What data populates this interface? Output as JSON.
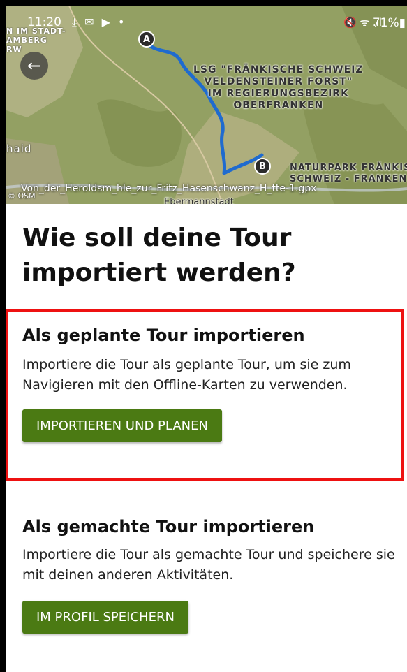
{
  "status_bar": {
    "time": "11:20",
    "left_icons": "⤓ ✉ ▶ •",
    "right_icons": "🔇 ᯤ .ıl",
    "battery": "71%"
  },
  "map": {
    "label_lsg": [
      "LSG \"FRÄNKISCHE SCHWEIZ",
      "VELDENSTEINER FORST\"",
      "IM REGIERUNGSBEZIRK",
      "OBERFRANKEN"
    ],
    "label_naturpark": [
      "NATURPARK FRÄNKIS",
      "SCHWEIZ - FRANKEN"
    ],
    "label_stadt": [
      "N IM STADT-",
      "AMBERG",
      "RW"
    ],
    "label_haid": "haid",
    "label_town": "Ebermannstadt",
    "filename": "Von_der_Heroldsm_hle_zur_Fritz_Hasenschwanz_H_tte-1.gpx",
    "attribution": "© OSM",
    "marker_start": "A",
    "marker_end": "B",
    "route_color": "#1f6bcf"
  },
  "title": "Wie soll deine Tour importiert werden?",
  "option_planned": {
    "heading": "Als geplante Tour importieren",
    "description": "Importiere die Tour als geplante Tour, um sie zum Navigieren mit den Offline-Karten zu verwenden.",
    "button": "IMPORTIEREN UND PLANEN"
  },
  "option_done": {
    "heading": "Als gemachte Tour importieren",
    "description": "Importiere die Tour als gemachte Tour und speichere sie mit deinen anderen Aktivitäten.",
    "button": "IM PROFIL SPEICHERN"
  },
  "colors": {
    "button_bg": "#4b7a13",
    "highlight": "#ee1111"
  }
}
